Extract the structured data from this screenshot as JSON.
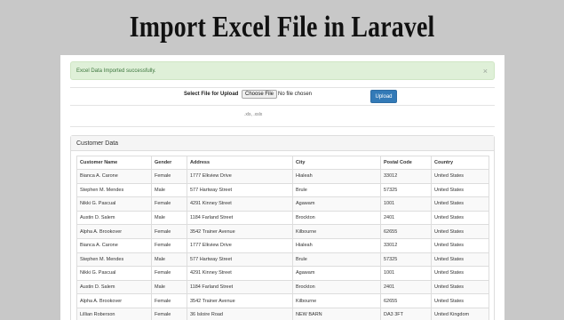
{
  "banner": {
    "title": "Import Excel File in Laravel"
  },
  "alert": {
    "message": "Excel Data Imported successfully.",
    "close": "×"
  },
  "upload": {
    "label": "Select File for Upload",
    "choose_label": "Choose File",
    "no_file_text": "No file chosen",
    "upload_label": "Upload",
    "hint": ".xls, .xslx"
  },
  "panel": {
    "title": "Customer Data"
  },
  "table": {
    "headers": [
      "Customer Name",
      "Gender",
      "Address",
      "City",
      "Postal Code",
      "Country"
    ],
    "rows": [
      [
        "Bianca A. Carone",
        "Female",
        "1777 Elkview Drive",
        "Hialeah",
        "33012",
        "United States"
      ],
      [
        "Stephen M. Mendes",
        "Male",
        "577 Hartway Street",
        "Brule",
        "57325",
        "United States"
      ],
      [
        "Nikki G. Pascual",
        "Female",
        "4291 Kinney Street",
        "Agawam",
        "1001",
        "United States"
      ],
      [
        "Austin D. Salem",
        "Male",
        "1184 Farland Street",
        "Brockton",
        "2401",
        "United States"
      ],
      [
        "Alpha A. Brookover",
        "Female",
        "3542 Trainer Avenue",
        "Kilbourne",
        "62655",
        "United States"
      ],
      [
        "Bianca A. Carone",
        "Female",
        "1777 Elkview Drive",
        "Hialeah",
        "33012",
        "United States"
      ],
      [
        "Stephen M. Mendes",
        "Male",
        "577 Hartway Street",
        "Brule",
        "57325",
        "United States"
      ],
      [
        "Nikki G. Pascual",
        "Female",
        "4291 Kinney Street",
        "Agawam",
        "1001",
        "United States"
      ],
      [
        "Austin D. Salem",
        "Male",
        "1184 Farland Street",
        "Brockton",
        "2401",
        "United States"
      ],
      [
        "Alpha A. Brookover",
        "Female",
        "3542 Trainer Avenue",
        "Kilbourne",
        "62655",
        "United States"
      ],
      [
        "Lillian Roberson",
        "Female",
        "36 Isloire Road",
        "NEW BARN",
        "DA3 3FT",
        "United Kingdom"
      ]
    ]
  }
}
